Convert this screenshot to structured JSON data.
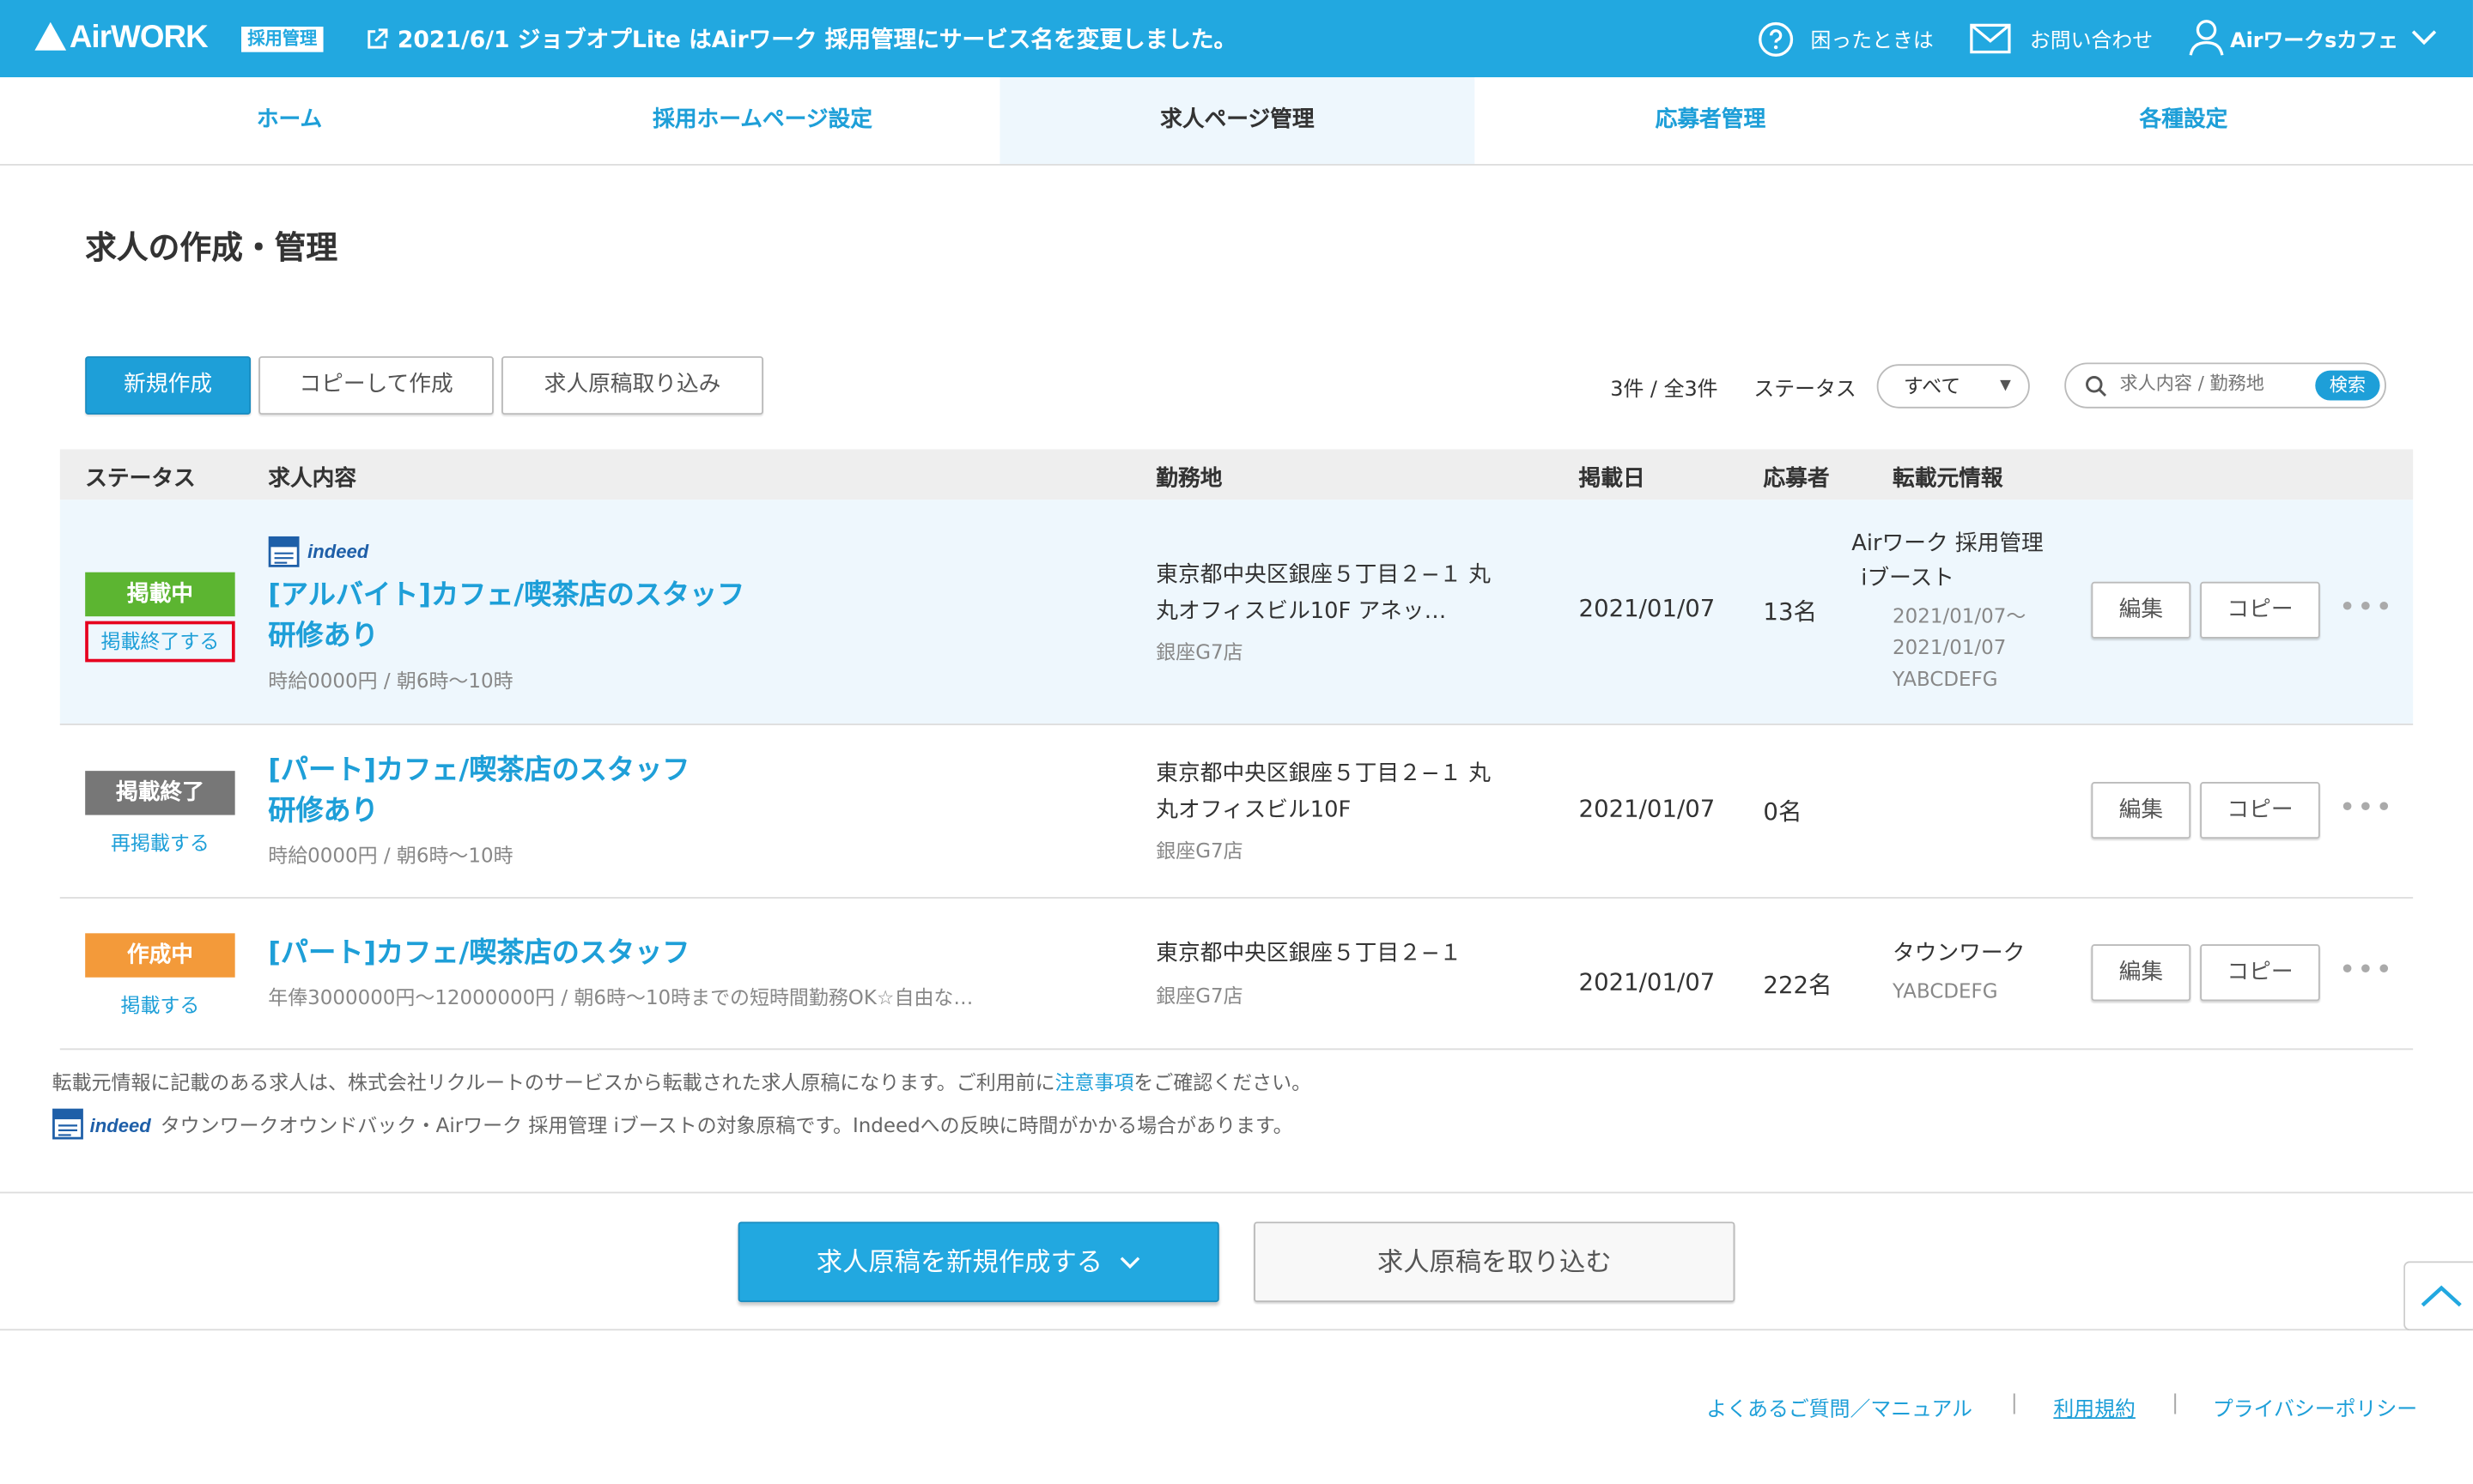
{
  "header": {
    "logo_text": "AirWORK",
    "logo_badge": "採用管理",
    "notice": "2021/6/1 ジョブオプLite はAirワーク 採用管理にサービス名を変更しました。",
    "help_label": "困ったときは",
    "contact_label": "お問い合わせ",
    "account_label": "Airワークsカフェ"
  },
  "nav": {
    "tabs": [
      {
        "label": "ホーム"
      },
      {
        "label": "採用ホームページ設定"
      },
      {
        "label": "求人ページ管理"
      },
      {
        "label": "応募者管理"
      },
      {
        "label": "各種設定"
      }
    ],
    "active": "求人ページ管理"
  },
  "page": {
    "title": "求人の作成・管理"
  },
  "toolbar": {
    "new_label": "新規作成",
    "copy_label": "コピーして作成",
    "import_label": "求人原稿取り込み",
    "count_text": "3件 / 全3件",
    "status_label": "ステータス",
    "status_value": "すべて",
    "search_placeholder": "求人内容 / 勤務地",
    "search_button": "検索"
  },
  "table": {
    "headers": {
      "status": "ステータス",
      "content": "求人内容",
      "location": "勤務地",
      "date": "掲載日",
      "applicants": "応募者",
      "source": "転載元情報"
    },
    "rows": [
      {
        "status": "掲載中",
        "status_action": "掲載終了する",
        "badge": "indeed",
        "title1": "[アルバイト]カフェ/喫茶店のスタッフ",
        "title2": "研修あり",
        "sub": "時給0000円 / 朝6時〜10時",
        "addr1": "東京都中央区銀座５丁目２−１ 丸",
        "addr2": "丸オフィスビル10F アネッ…",
        "store": "銀座G7店",
        "date": "2021/01/07",
        "applicants": "13名",
        "src1": "Airワーク 採用管理",
        "src2": "iブースト",
        "src3": "2021/01/07〜",
        "src4": "2021/01/07",
        "src5": "YABCDEFG",
        "edit": "編集",
        "copy": "コピー"
      },
      {
        "status": "掲載終了",
        "status_action": "再掲載する",
        "title1": "[パート]カフェ/喫茶店のスタッフ",
        "title2": "研修あり",
        "sub": "時給0000円 / 朝6時〜10時",
        "addr1": "東京都中央区銀座５丁目２−１ 丸",
        "addr2": "丸オフィスビル10F",
        "store": "銀座G7店",
        "date": "2021/01/07",
        "applicants": "0名",
        "edit": "編集",
        "copy": "コピー"
      },
      {
        "status": "作成中",
        "status_action": "掲載する",
        "title1": "[パート]カフェ/喫茶店のスタッフ",
        "sub": "年俸3000000円〜12000000円 / 朝6時〜10時までの短時間勤務OK☆自由な…",
        "addr1": "東京都中央区銀座５丁目２−１",
        "store": "銀座G7店",
        "date": "2021/01/07",
        "applicants": "222名",
        "src1": "タウンワーク",
        "src2": "YABCDEFG",
        "edit": "編集",
        "copy": "コピー"
      }
    ]
  },
  "notes": {
    "note1_pre": "転載元情報に記載のある求人は、株式会社リクルートのサービスから転載された求人原稿になります。ご利用前に",
    "note1_link": "注意事項",
    "note1_post": "をご確認ください。",
    "note2": "タウンワークオウンドバック・Airワーク 採用管理 iブーストの対象原稿です。Indeedへの反映に時間がかかる場合があります。"
  },
  "actions": {
    "create_label": "求人原稿を新規作成する",
    "import_label": "求人原稿を取り込む"
  },
  "footer": {
    "faq": "よくあるご質問／マニュアル",
    "terms": "利用規約",
    "privacy": "プライバシーポリシー"
  },
  "colors": {
    "brand": "#22a8e0",
    "link": "#1e9fd8",
    "status_live": "#5cb531",
    "status_ended": "#777777",
    "status_draft": "#f39a3a",
    "highlight_box": "#e6001e"
  }
}
